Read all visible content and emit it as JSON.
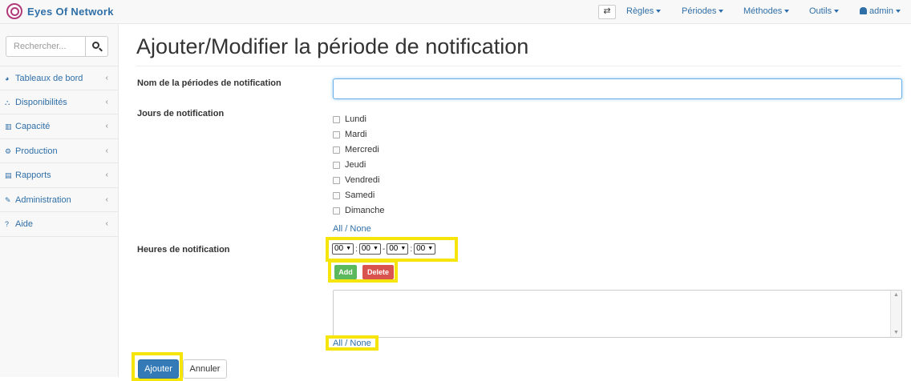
{
  "app": {
    "brand": "Eyes Of Network"
  },
  "navbar": {
    "toggle_glyph": "⇄",
    "menus": [
      {
        "label": "Règles"
      },
      {
        "label": "Périodes"
      },
      {
        "label": "Méthodes"
      },
      {
        "label": "Outils"
      },
      {
        "label": "admin"
      }
    ]
  },
  "sidebar": {
    "search_placeholder": "Rechercher...",
    "items": [
      {
        "label": "Tableaux de bord",
        "icon": "dashboard-icon"
      },
      {
        "label": "Disponibilités",
        "icon": "sitemap-icon"
      },
      {
        "label": "Capacité",
        "icon": "bar-chart-icon"
      },
      {
        "label": "Production",
        "icon": "cogs-icon"
      },
      {
        "label": "Rapports",
        "icon": "file-text-icon"
      },
      {
        "label": "Administration",
        "icon": "wrench-icon"
      },
      {
        "label": "Aide",
        "icon": "question-circle-icon"
      }
    ]
  },
  "page": {
    "title": "Ajouter/Modifier la période de notification",
    "name_label": "Nom de la périodes de notification",
    "name_value": "",
    "days_label": "Jours de notification",
    "days": [
      {
        "label": "Lundi",
        "checked": false
      },
      {
        "label": "Mardi",
        "checked": false
      },
      {
        "label": "Mercredi",
        "checked": false
      },
      {
        "label": "Jeudi",
        "checked": false
      },
      {
        "label": "Vendredi",
        "checked": false
      },
      {
        "label": "Samedi",
        "checked": false
      },
      {
        "label": "Dimanche",
        "checked": false
      }
    ],
    "days_all_none": "All / None",
    "hours_label": "Heures de notification",
    "time_selects": [
      "00",
      "00",
      "00",
      "00"
    ],
    "time_seps": [
      ":",
      "-",
      ":"
    ],
    "add_label": "Add",
    "delete_label": "Delete",
    "hours_all_none": "All / None",
    "submit_label": "Ajouter",
    "cancel_label": "Annuler"
  },
  "colors": {
    "highlight": "#f5e50a",
    "primary": "#337ab7",
    "success": "#5cb85c",
    "danger": "#d9534f",
    "link": "#2f6fa7"
  }
}
